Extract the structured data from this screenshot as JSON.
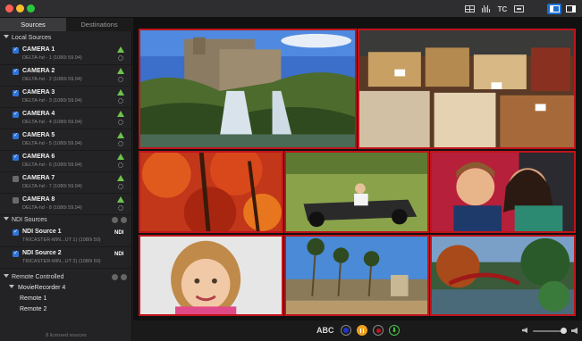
{
  "titlebar": {
    "tc_label": "TC"
  },
  "sidebar": {
    "tabs": [
      {
        "label": "Sources",
        "active": true
      },
      {
        "label": "Destinations",
        "active": false
      }
    ],
    "local_sources": {
      "title": "Local Sources",
      "items": [
        {
          "name": "CAMERA 1",
          "sub": "DELTA-hd - 1 (1080i 59.94)",
          "checked": true
        },
        {
          "name": "CAMERA 2",
          "sub": "DELTA-hd - 2 (1080i 59.94)",
          "checked": true
        },
        {
          "name": "CAMERA 3",
          "sub": "DELTA-hd - 3 (1080i 59.94)",
          "checked": true
        },
        {
          "name": "CAMERA 4",
          "sub": "DELTA-hd - 4 (1080i 59.94)",
          "checked": true
        },
        {
          "name": "CAMERA 5",
          "sub": "DELTA-hd - 5 (1080i 59.94)",
          "checked": true
        },
        {
          "name": "CAMERA 6",
          "sub": "DELTA-hd - 6 (1080i 59.94)",
          "checked": true
        },
        {
          "name": "CAMERA 7",
          "sub": "DELTA-hd - 7 (1080i 59.94)",
          "checked": false
        },
        {
          "name": "CAMERA 8",
          "sub": "DELTA-hd - 8 (1080i 59.94)",
          "checked": false
        }
      ]
    },
    "ndi_sources": {
      "title": "NDI Sources",
      "items": [
        {
          "name": "NDI Source 1",
          "sub": "TRICASTER-MIN...UT 1) (1080i 50)",
          "badge": "NDI",
          "checked": true
        },
        {
          "name": "NDI Source 2",
          "sub": "TRICASTER-MIN...UT 2) (1080i 50)",
          "badge": "NDI",
          "checked": true
        }
      ]
    },
    "remote_controlled": {
      "title": "Remote Controlled",
      "recorder": "MovieRecorder 4",
      "remotes": [
        "Remote 1",
        "Remote 2"
      ]
    },
    "footer": "8 licensed sources"
  },
  "bottombar": {
    "abc_label": "ABC",
    "download_glyph": "⬇"
  },
  "colors": {
    "accent": "#2d73d8",
    "tile_border": "#c0141c",
    "status_green": "#6fc24d",
    "pause_orange": "#f0a020"
  }
}
